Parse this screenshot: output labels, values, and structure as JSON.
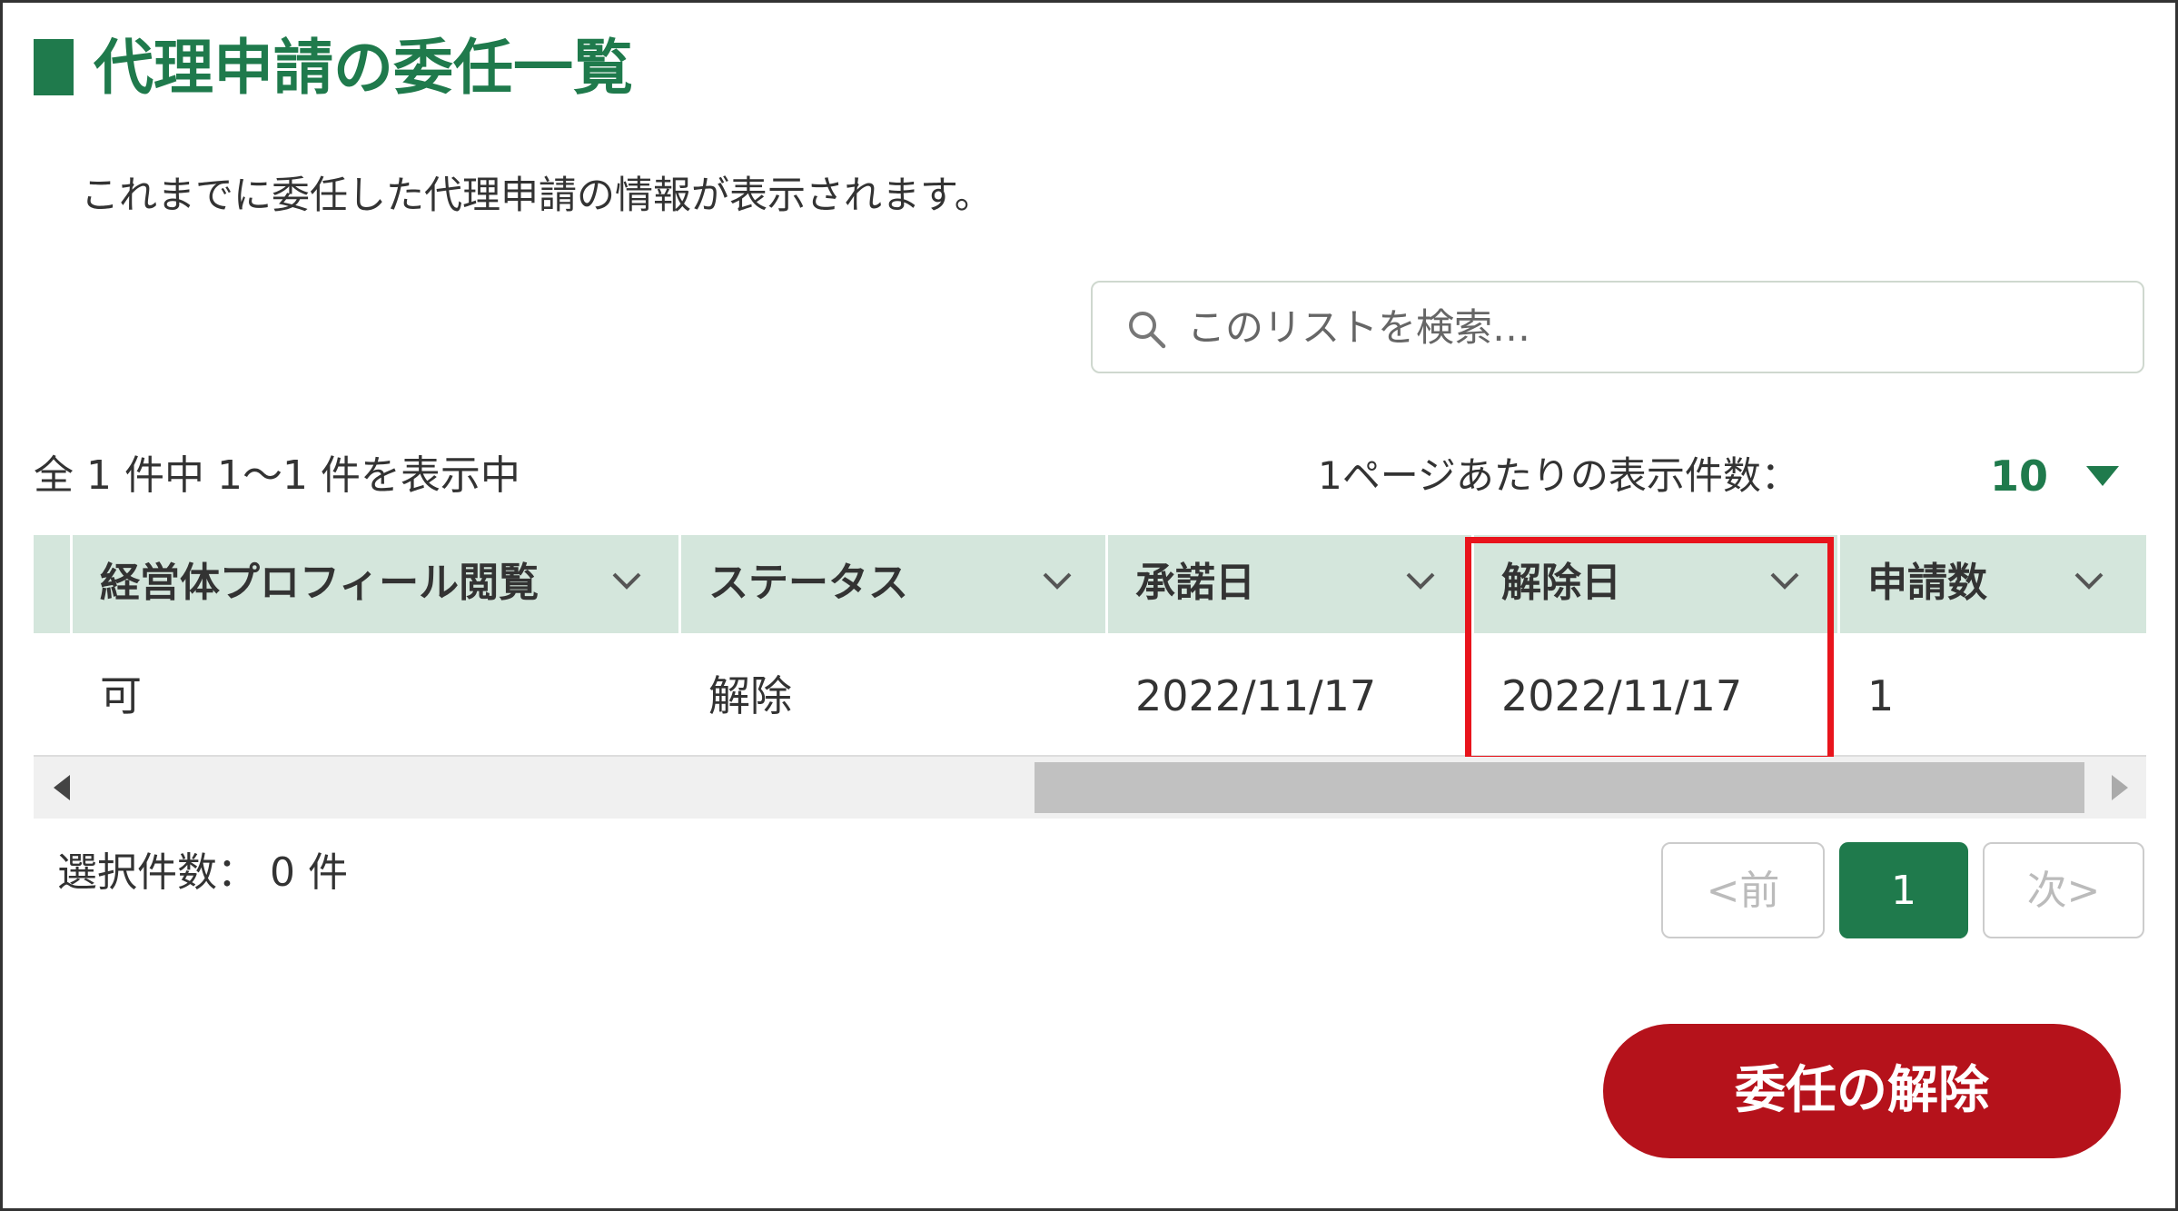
{
  "page": {
    "title": "代理申請の委任一覧",
    "description": "これまでに委任した代理申請の情報が表示されます。"
  },
  "search": {
    "placeholder": "このリストを検索…",
    "icon": "search-icon"
  },
  "list": {
    "result_count": "全 1 件中 1～1 件を表示中",
    "per_page_label": "1ページあたりの表示件数：",
    "per_page_value": "10"
  },
  "table": {
    "columns": [
      {
        "label": "経営体プロフィール閲覧",
        "icon": "chevron-down-icon"
      },
      {
        "label": "ステータス",
        "icon": "chevron-down-icon"
      },
      {
        "label": "承諾日",
        "icon": "chevron-down-icon"
      },
      {
        "label": "解除日",
        "icon": "chevron-down-icon"
      },
      {
        "label": "申請数",
        "icon": "chevron-down-icon"
      }
    ],
    "rows": [
      {
        "cells": [
          "可",
          "解除",
          "2022/11/17",
          "2022/11/17",
          "1"
        ]
      }
    ],
    "highlight_color": "#e8141c"
  },
  "selection": {
    "count_text": "選択件数： 0 件"
  },
  "pagination": {
    "prev_label": "<前",
    "current_page": "1",
    "next_label": "次>"
  },
  "actions": {
    "revoke_label": "委任の解除"
  },
  "colors": {
    "brand_green": "#1f7a4c",
    "header_bg": "#d4e6dc",
    "danger_red": "#b5121b"
  }
}
